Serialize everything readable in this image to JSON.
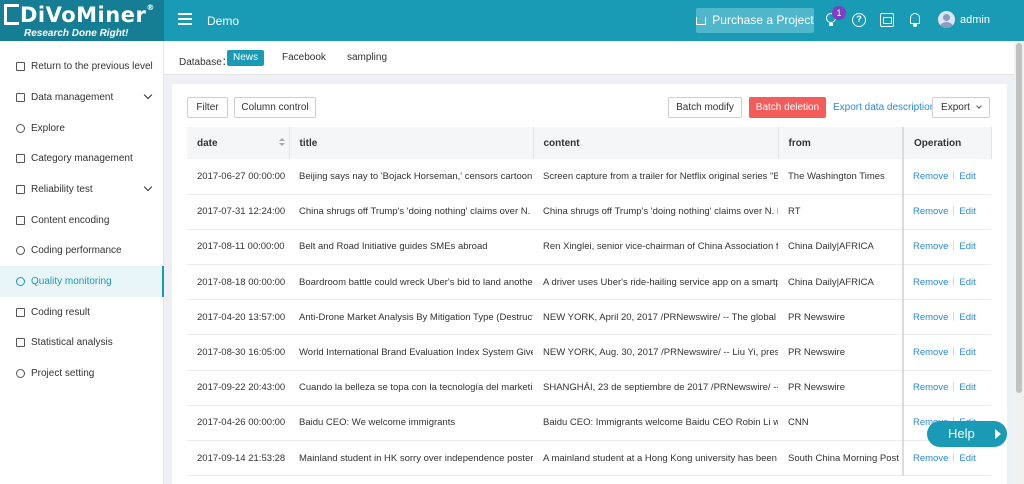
{
  "header": {
    "logo_text": "DiVoMiner",
    "logo_tagline": "Research Done Right!",
    "project_name": "Demo",
    "purchase_label": "Purchase a Project",
    "notification_count": "1",
    "user_name": "admin",
    "brand_color": "#1a9bb5"
  },
  "sidebar": {
    "items": [
      {
        "label": "Return to the previous level",
        "icon": "return-icon"
      },
      {
        "label": "Data management",
        "icon": "document-icon",
        "expandable": true
      },
      {
        "label": "Explore",
        "icon": "compass-icon"
      },
      {
        "label": "Category management",
        "icon": "list-icon"
      },
      {
        "label": "Reliability test",
        "icon": "checklist-icon",
        "expandable": true
      },
      {
        "label": "Content encoding",
        "icon": "pencil-icon"
      },
      {
        "label": "Coding performance",
        "icon": "dashboard-icon"
      },
      {
        "label": "Quality monitoring",
        "icon": "eye-icon",
        "active": true
      },
      {
        "label": "Coding result",
        "icon": "file-icon"
      },
      {
        "label": "Statistical analysis",
        "icon": "chart-icon"
      },
      {
        "label": "Project setting",
        "icon": "gear-icon"
      }
    ]
  },
  "database": {
    "label": "Database：",
    "tabs": [
      "News",
      "Facebook",
      "sampling"
    ],
    "active": "News"
  },
  "toolbar": {
    "filter": "Filter",
    "column_control": "Column control",
    "batch_modify": "Batch modify",
    "batch_deletion": "Batch deletion",
    "export_desc": "Export data description",
    "export": "Export"
  },
  "table": {
    "columns": [
      "date",
      "title",
      "content",
      "from",
      "Operation"
    ],
    "remove_label": "Remove",
    "edit_label": "Edit",
    "rows": [
      {
        "date": "2017-06-27 00:00:00",
        "title": "Beijing says nay to 'Bojack Horseman,' censors cartoon fr",
        "content": "Screen capture from a trailer for Netflix original series \"Bo",
        "from": "The Washington Times"
      },
      {
        "date": "2017-07-31 12:24:00",
        "title": "China shrugs off Trump's 'doing nothing' claims over N. K",
        "content": "China shrugs off Trump's 'doing nothing' claims over N. K",
        "from": "RT"
      },
      {
        "date": "2017-08-11 00:00:00",
        "title": "Belt and Road Initiative guides SMEs abroad",
        "content": "Ren Xinglei, senior vice-chairman of China Association fo",
        "from": "China Daily|AFRICA"
      },
      {
        "date": "2017-08-18 00:00:00",
        "title": "Boardroom battle could wreck Uber's bid to land another",
        "content": "A driver uses Uber's ride-hailing service app on a smartpl",
        "from": "China Daily|AFRICA"
      },
      {
        "date": "2017-04-20 13:57:00",
        "title": "Anti-Drone Market Analysis By Mitigation Type (Destructi",
        "content": "NEW YORK, April 20, 2017 /PRNewswire/ -- The global ar",
        "from": "PR Newswire"
      },
      {
        "date": "2017-08-30 16:05:00",
        "title": "World International Brand Evaluation Index System Gives",
        "content": "NEW YORK, Aug. 30, 2017 /PRNewswire/ -- Liu Yi, preside",
        "from": "PR Newswire"
      },
      {
        "date": "2017-09-22 20:43:00",
        "title": "Cuando la belleza se topa con la tecnología del marketin",
        "content": "SHANGHÁI, 23 de septiembre de 2017 /PRNewswire/ -- E",
        "from": "PR Newswire"
      },
      {
        "date": "2017-04-26 00:00:00",
        "title": "Baidu CEO: We welcome immigrants",
        "content": "Baidu CEO: Immigrants welcome Baidu CEO Robin Li wan",
        "from": "CNN"
      },
      {
        "date": "2017-09-14 21:53:28",
        "title": "Mainland student in HK sorry over independence poster",
        "content": "A mainland student at a Hong Kong university has been t",
        "from": "South China Morning Post"
      }
    ]
  },
  "help_button": "Help"
}
